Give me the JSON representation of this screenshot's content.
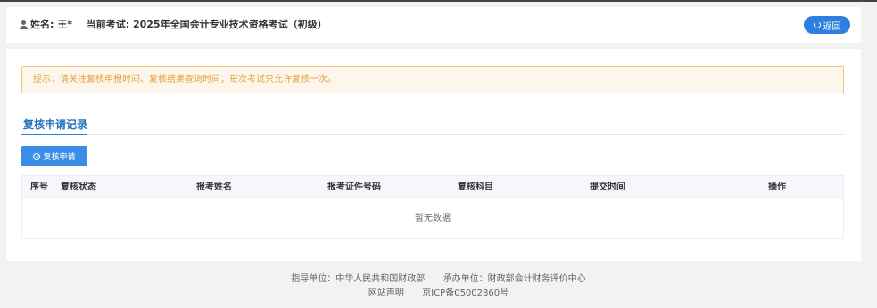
{
  "header": {
    "user_icon": "user-icon",
    "name_label": "姓名:",
    "name_value": "王*",
    "exam_label": "当前考试:",
    "exam_value": "2025年全国会计专业技术资格考试（初级）",
    "back_label": "返回",
    "back_icon": "refresh-icon"
  },
  "notice": {
    "text": "提示：请关注复核申报时间、复核结果查询时间；每次考试只允许复核一次。"
  },
  "section": {
    "title": "复核申请记录"
  },
  "toolbar": {
    "apply_label": "复核申请",
    "apply_icon": "plus-circle-icon"
  },
  "table": {
    "columns": [
      "序号",
      "复核状态",
      "报考姓名",
      "报考证件号码",
      "复核科目",
      "提交时间",
      "操作"
    ],
    "empty_text": "暂无数据"
  },
  "footer": {
    "guide": "指导单位：中华人民共和国财政部",
    "host": "承办单位：财政部会计财务评价中心",
    "statement": "网站声明",
    "icp": "京ICP备05002860号"
  },
  "colors": {
    "primary": "#2f7fe0",
    "notice_text": "#e6a23c",
    "notice_bg": "#fdf6ec",
    "notice_border": "#f5c27a",
    "page_bg": "#f2f2f2"
  }
}
